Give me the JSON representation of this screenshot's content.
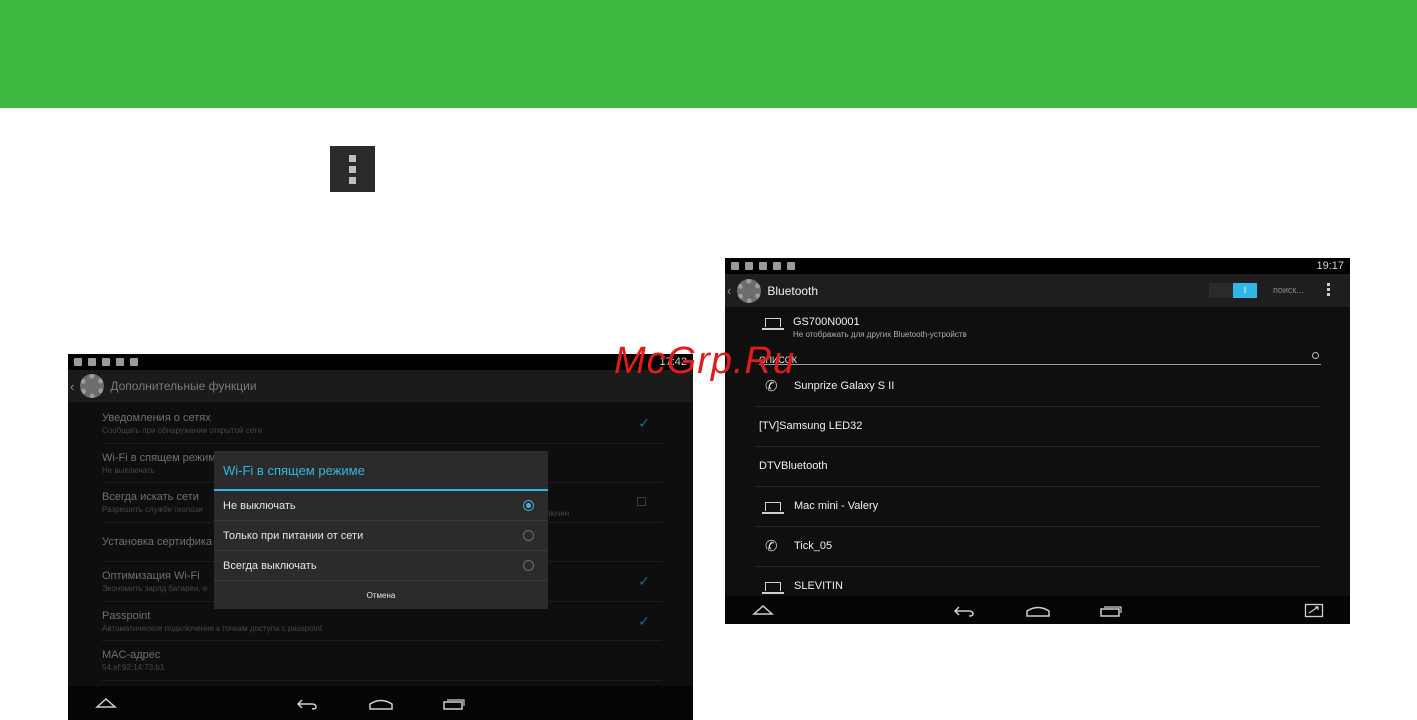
{
  "watermark": "McGrp.Ru",
  "screen_wifi": {
    "status_time": "17:42",
    "title": "Дополнительные функции",
    "settings": [
      {
        "title": "Уведомления о сетях",
        "subtitle": "Сообщать при обнаружении открытой сети",
        "checked": true
      },
      {
        "title": "Wi-Fi в спящем режиме",
        "subtitle": "Не выключать"
      },
      {
        "title": "Всегда искать сети",
        "subtitle": "Разрешить службе геопози",
        "subtitle_tail": "ключен",
        "checkbox": true
      },
      {
        "title": "Установка сертифика",
        "subtitle": ""
      },
      {
        "title": "Оптимизация Wi-Fi",
        "subtitle": "Экономить заряд батареи, е",
        "checked": true
      },
      {
        "title": "Passpoint",
        "subtitle": "Автоматическое подключение к точкам доступа с passpoint",
        "checked": true
      },
      {
        "title": "MAC-адрес",
        "subtitle": "54:ef:92:14:73:b1"
      }
    ],
    "dialog": {
      "title": "Wi-Fi в спящем режиме",
      "options": [
        "Не выключать",
        "Только при питании от сети",
        "Всегда выключать"
      ],
      "selected_index": 0,
      "cancel_label": "Отмена"
    }
  },
  "screen_bluetooth": {
    "status_time": "19:17",
    "title": "Bluetooth",
    "toggle_label": "I",
    "search_label": "поиск...",
    "device_name": "GS700N0001",
    "device_subtitle": "Не отображать для других Bluetooth-устройств",
    "section_label": "СПИСОК",
    "devices": [
      {
        "name": "Sunprize Galaxy S II",
        "icon": "phone-icon"
      },
      {
        "name": "[TV]Samsung LED32",
        "icon": ""
      },
      {
        "name": "DTVBluetooth",
        "icon": ""
      },
      {
        "name": "Mac mini - Valery",
        "icon": "laptop-icon"
      },
      {
        "name": "Tick_05",
        "icon": "phone-icon"
      },
      {
        "name": "SLEVITIN",
        "icon": "laptop-icon"
      }
    ]
  },
  "colors": {
    "banner": "#3dba3f",
    "accent": "#33b5e5",
    "watermark": "#e01b1b"
  }
}
